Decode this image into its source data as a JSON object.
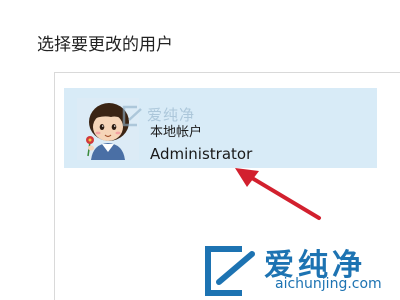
{
  "page": {
    "heading": "选择要更改的用户"
  },
  "user_card": {
    "account_type": "本地帐户",
    "username": "Administrator"
  },
  "watermark": {
    "small_text": "爱纯净",
    "title": "爱纯净",
    "url": "aichunjing.com"
  },
  "colors": {
    "card_background": "#d8ebf7",
    "arrow": "#d2202e",
    "watermark_blue": "#1d73b2"
  },
  "icons": {
    "avatar": "cartoon-boy-avatar",
    "watermark_logo": "aichunjing-logo-icon",
    "annotation": "red-arrow-icon"
  }
}
